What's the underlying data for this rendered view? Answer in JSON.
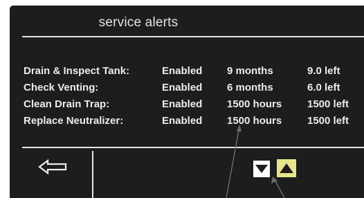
{
  "screen": {
    "title": "service alerts",
    "alerts": [
      {
        "name": "Drain & Inspect Tank:",
        "status": "Enabled",
        "interval": "9 months",
        "remaining": "9.0 left"
      },
      {
        "name": "Check Venting:",
        "status": "Enabled",
        "interval": "6 months",
        "remaining": "6.0 left"
      },
      {
        "name": "Clean Drain Trap:",
        "status": "Enabled",
        "interval": "1500 hours",
        "remaining": "1500 left"
      },
      {
        "name": "Replace Neutralizer:",
        "status": "Enabled",
        "interval": "1500 hours",
        "remaining": "1500 left"
      }
    ]
  },
  "footer": {
    "back_icon": "back-arrow-icon",
    "down_icon": "down-triangle-icon",
    "up_icon": "up-triangle-icon"
  },
  "colors": {
    "screen_background": "#1d1d1d",
    "text": "#ececec",
    "up_button": "#e8e58a",
    "down_button": "#ffffff",
    "callout_line": "#6d6d6d"
  }
}
